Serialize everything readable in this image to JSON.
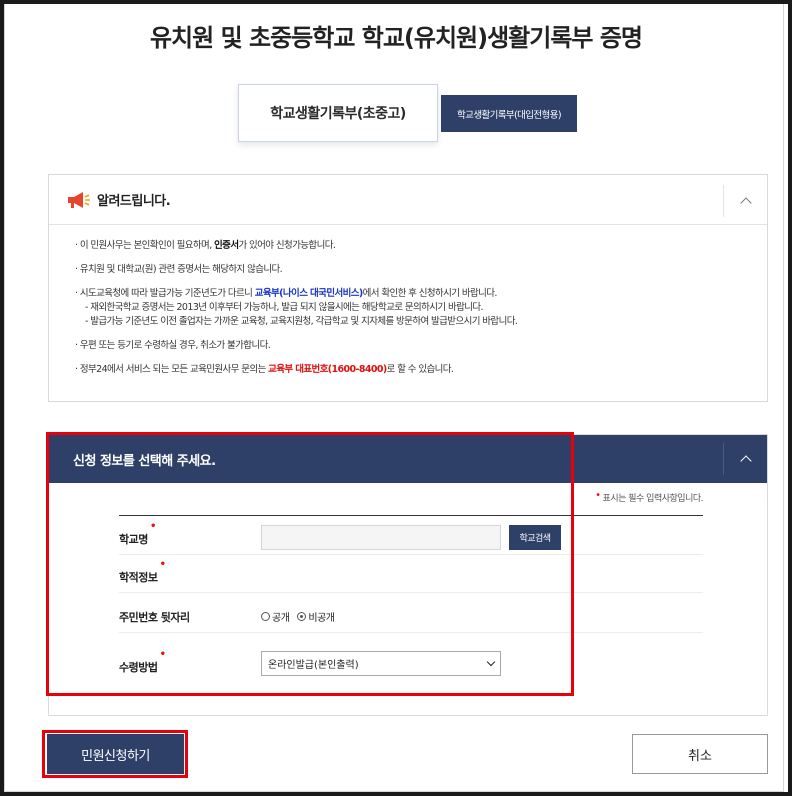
{
  "page": {
    "title": "유치원 및 초중등학교 학교(유치원)생활기록부 증명"
  },
  "tabs": [
    {
      "label": "학교생활기록부(초중고)",
      "active": true
    },
    {
      "label": "학교생활기록부(대입전형용)",
      "active": false
    }
  ],
  "notice": {
    "title": "알려드립니다.",
    "items": {
      "i1_pre": "· 이 민원사무는 본인확인이 필요하며, ",
      "i1_bold": "인증서",
      "i1_post": "가 있어야 신청가능합니다.",
      "i2": "· 유치원 및 대학교(원) 관련 증명서는 해당하지 않습니다.",
      "i3_pre": "· 시도교육청에 따라 발급가능 기준년도가 다르니 ",
      "i3_link": "교육부(나이스 대국민서비스)",
      "i3_post": "에서 확인한 후 신청하시기 바랍니다.",
      "i3_sub1": "- 재외한국학교 증명서는 2013년 이후부터 가능하나, 발급 되지 않을시에는 해당학교로 문의하시기 바랍니다.",
      "i3_sub2": "- 발급가능 기준년도 이전 졸업자는 가까운 교육청, 교육지원청, 각급학교 및 지자체를 방문하여 발급받으시기 바랍니다.",
      "i4": "· 우편 또는 등기로 수령하실 경우, 취소가 불가합니다.",
      "i5_pre": "· 정부24에서 서비스 되는 모든 교육민원사무 문의는 ",
      "i5_red": "교육부 대표번호(1600-8400)",
      "i5_post": "로 할 수 있습니다."
    }
  },
  "form": {
    "title": "신청 정보를 선택해 주세요.",
    "required_note": "표시는 필수 입력사항입니다.",
    "school": {
      "label": "학교명",
      "value": "",
      "search_button": "학교검색"
    },
    "academic": {
      "label": "학적정보"
    },
    "resident": {
      "label": "주민번호 뒷자리",
      "options": [
        "공개",
        "비공개"
      ],
      "selected": "비공개"
    },
    "receive": {
      "label": "수령방법",
      "selected": "온라인발급(본인출력)"
    }
  },
  "buttons": {
    "submit": "민원신청하기",
    "cancel": "취소"
  },
  "colors": {
    "primary_navy": "#2e4068",
    "highlight_red": "#e8000b",
    "link_blue": "#1a35c9"
  }
}
